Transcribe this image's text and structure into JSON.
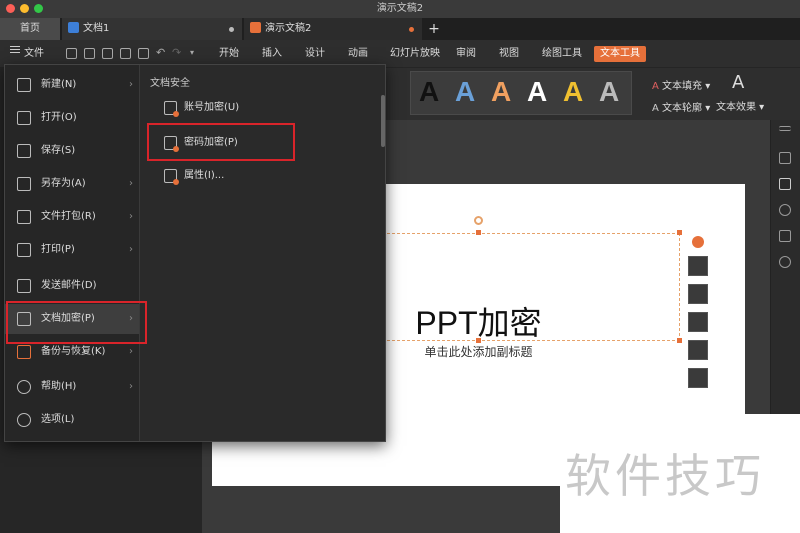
{
  "window": {
    "title": "演示文稿2"
  },
  "tabs": [
    {
      "label": "首页"
    },
    {
      "label": "文档1"
    },
    {
      "label": "演示文稿2"
    }
  ],
  "menubar": {
    "file_label": "文件",
    "items": [
      "开始",
      "插入",
      "设计",
      "动画",
      "幻灯片放映",
      "审阅",
      "视图",
      "绘图工具",
      "文本工具"
    ],
    "active_item": "文本工具"
  },
  "ribbon": {
    "text_fill": "文本填充",
    "text_outline": "文本轮廓",
    "text_effects": "文本效果",
    "style_letters": [
      "A",
      "A",
      "A",
      "A",
      "A",
      "A"
    ],
    "style_colors": [
      "#111111",
      "#6aa0d8",
      "#f0a060",
      "#ffffff",
      "#f0c030",
      "#bbbbbb"
    ]
  },
  "file_menu": {
    "items": [
      {
        "label": "新建(N)",
        "icon": "new-doc-icon",
        "has_submenu": true
      },
      {
        "label": "打开(O)",
        "icon": "folder-icon",
        "has_submenu": false
      },
      {
        "label": "保存(S)",
        "icon": "save-icon",
        "has_submenu": false
      },
      {
        "label": "另存为(A)",
        "icon": "save-as-icon",
        "has_submenu": true
      },
      {
        "label": "文件打包(R)",
        "icon": "package-icon",
        "has_submenu": true
      },
      {
        "label": "打印(P)",
        "icon": "print-icon",
        "has_submenu": true
      },
      {
        "label": "发送邮件(D)",
        "icon": "mail-icon",
        "has_submenu": false
      },
      {
        "label": "文档加密(P)",
        "icon": "encrypt-icon",
        "has_submenu": true
      },
      {
        "label": "备份与恢复(K)",
        "icon": "backup-icon",
        "has_submenu": true
      },
      {
        "label": "帮助(H)",
        "icon": "help-icon",
        "has_submenu": true
      },
      {
        "label": "选项(L)",
        "icon": "gear-icon",
        "has_submenu": false
      }
    ],
    "selected": "文档加密(P)",
    "submenu": {
      "header": "文档安全",
      "items": [
        "账号加密(U)",
        "密码加密(P)",
        "属性(I)..."
      ]
    }
  },
  "slide": {
    "title": "PPT加密",
    "subtitle": "单击此处添加副标题"
  },
  "watermark": "软件技巧",
  "colors": {
    "accent": "#e6703a",
    "highlight_box": "#d9242a"
  }
}
